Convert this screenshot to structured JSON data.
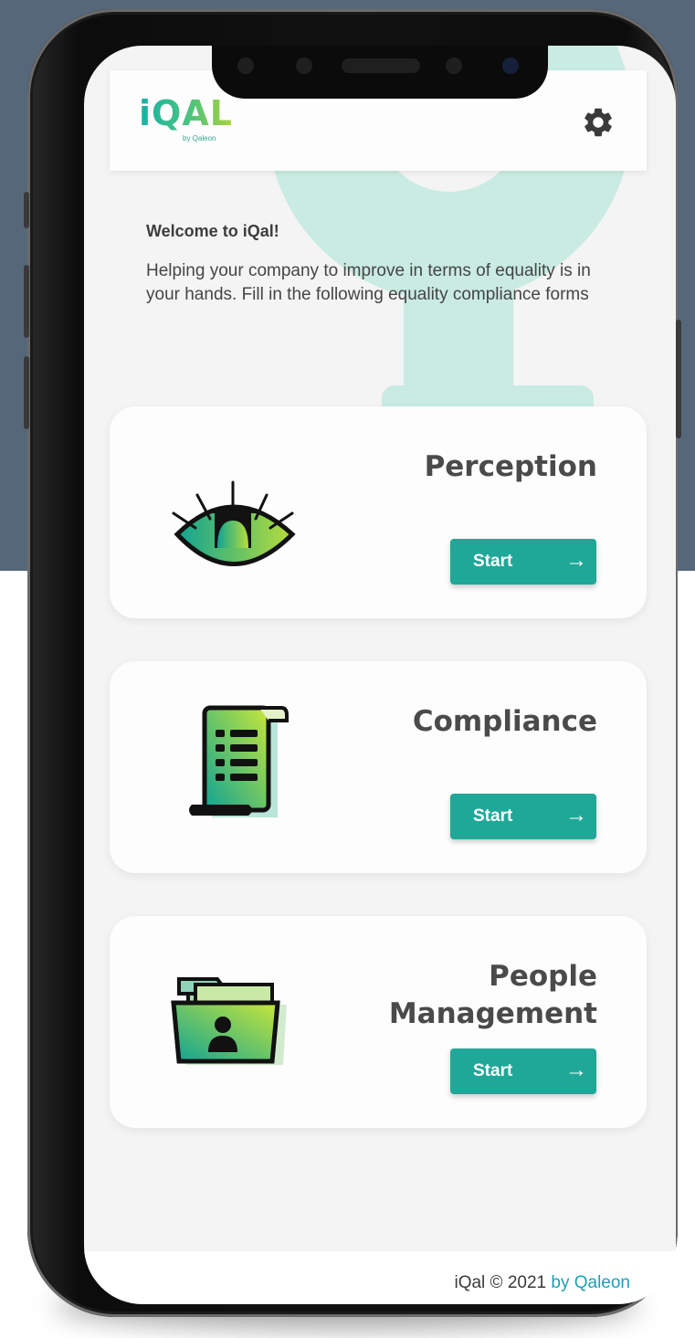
{
  "app": {
    "logo_text": "iQAL",
    "logo_sub": "by Qaleon"
  },
  "welcome": {
    "title": "Welcome to iQal!",
    "body": "Helping your company to improve in terms of equality is in your hands. Fill in the following equality compliance forms"
  },
  "cards": [
    {
      "title": "Perception",
      "button": "Start",
      "icon": "eye-icon"
    },
    {
      "title": "Compliance",
      "button": "Start",
      "icon": "document-scroll-icon"
    },
    {
      "title_line1": "People",
      "title_line2": "Management",
      "button": "Start",
      "icon": "folder-person-icon"
    }
  ],
  "footer": {
    "text": "iQal © 2021",
    "brand": "by Qaleon"
  },
  "colors": {
    "accent": "#1fa898",
    "background_top": "#56677a",
    "decoration": "#c9ebe2",
    "brand_link": "#1c9fb4"
  }
}
